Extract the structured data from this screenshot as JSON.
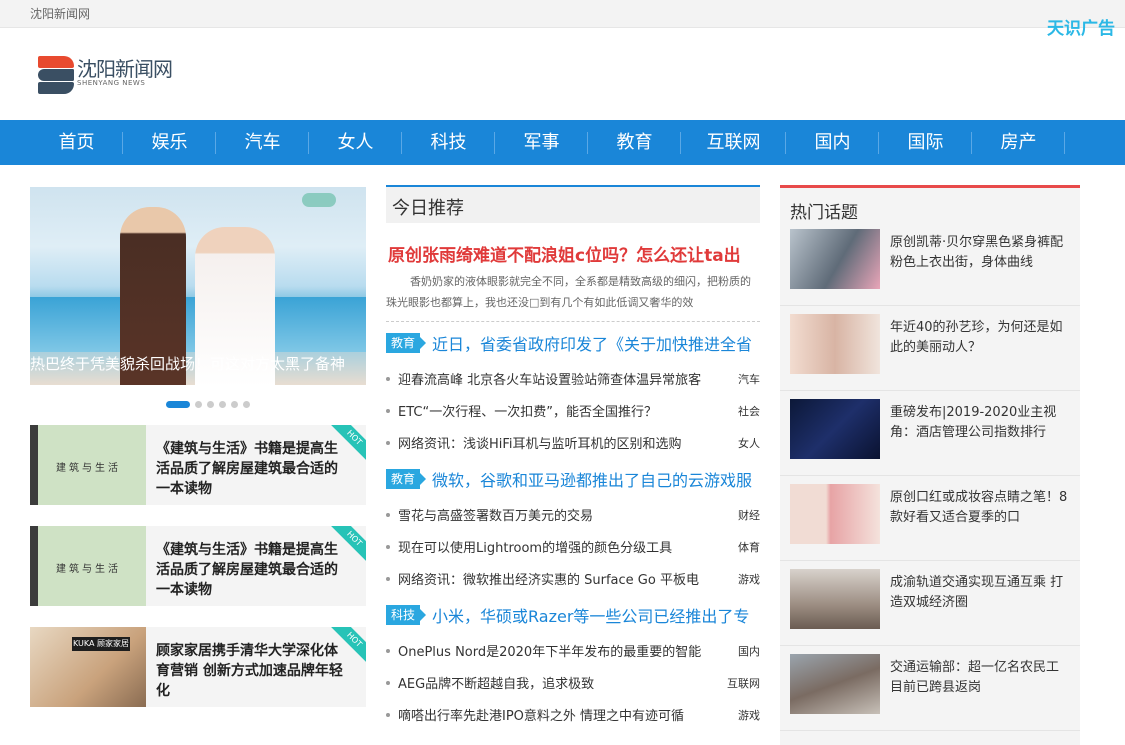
{
  "topbar": {
    "site_name": "沈阳新闻网",
    "ad_label": "天识广告"
  },
  "logo": {
    "cn": "沈阳新闻网",
    "en": "SHENYANG NEWS"
  },
  "nav": [
    "首页",
    "娱乐",
    "汽车",
    "女人",
    "科技",
    "军事",
    "教育",
    "互联网",
    "国内",
    "国际",
    "房产"
  ],
  "slider": {
    "caption": "热巴终于凭美貌杀回战场！可这对方太黑了备神"
  },
  "cards": [
    {
      "title": "《建筑与生活》书籍是提高生活品质了解房屋建筑最合适的一本读物",
      "badge": "HOT",
      "thumb_text": "建筑与生活"
    },
    {
      "title": "《建筑与生活》书籍是提高生活品质了解房屋建筑最合适的一本读物",
      "badge": "HOT",
      "thumb_text": "建筑与生活"
    },
    {
      "title": "顾家家居携手清华大学深化体育营销 创新方式加速品牌年轻化",
      "badge": "HOT",
      "thumb_text": "KUKA 顾家家居"
    }
  ],
  "recommend": {
    "title": "今日推荐",
    "headline": "原创张雨绮难道不配浪姐c位吗？怎么还让ta出",
    "summary": "香奶奶家的液体眼影就完全不同，全系都是精致高级的细闪，把粉质的珠光眼影也都算上，我也还没□到有几个有如此低调又奢华的效"
  },
  "sections": [
    {
      "tag": "教育",
      "title": "近日，省委省政府印发了《关于加快推进全省",
      "items": [
        {
          "text": "迎春流高峰 北京各火车站设置验站筛查体温异常旅客",
          "cat": "汽车"
        },
        {
          "text": "ETC“一次行程、一次扣费”，能否全国推行？",
          "cat": "社会"
        },
        {
          "text": "网络资讯：浅谈HiFi耳机与监听耳机的区别和选购",
          "cat": "女人"
        }
      ]
    },
    {
      "tag": "教育",
      "title": "微软，谷歌和亚马逊都推出了自己的云游戏服",
      "items": [
        {
          "text": "雪花与高盛签署数百万美元的交易",
          "cat": "财经"
        },
        {
          "text": "现在可以使用Lightroom的增强的颜色分级工具",
          "cat": "体育"
        },
        {
          "text": "网络资讯：微软推出经济实惠的 Surface Go 平板电",
          "cat": "游戏"
        }
      ]
    },
    {
      "tag": "科技",
      "title": "小米，华硕或Razer等一些公司已经推出了专",
      "items": [
        {
          "text": "OnePlus Nord是2020年下半年发布的最重要的智能",
          "cat": "国内"
        },
        {
          "text": "AEG品牌不断超越自我，追求极致",
          "cat": "互联网"
        },
        {
          "text": "嘀嗒出行率先赴港IPO意料之外 情理之中有迹可循",
          "cat": "游戏"
        }
      ]
    }
  ],
  "hot": {
    "title": "热门话题",
    "items": [
      {
        "text": "原创凯蒂·贝尔穿黑色紧身裤配粉色上衣出街，身体曲线"
      },
      {
        "text": "年近40的孙艺珍，为何还是如此的美丽动人？"
      },
      {
        "text": "重磅发布|2019-2020业主视角：酒店管理公司指数排行"
      },
      {
        "text": "原创口红或成妆容点睛之笔！8款好看又适合夏季的口"
      },
      {
        "text": "成渝轨道交通实现互通互乘 打造双城经济圈"
      },
      {
        "text": "交通运输部：超一亿名农民工目前已跨县返岗"
      }
    ]
  }
}
